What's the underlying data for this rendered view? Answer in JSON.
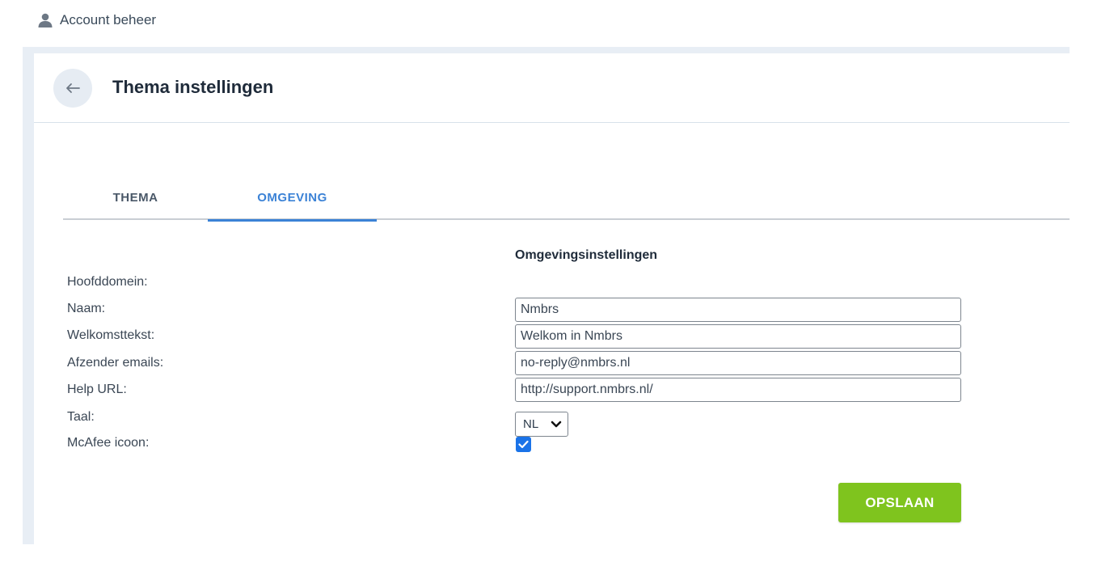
{
  "topbar": {
    "title": "Account beheer",
    "icon": "user-icon"
  },
  "header": {
    "title": "Thema instellingen",
    "back_icon": "arrow-left-icon"
  },
  "tabs": [
    {
      "label": "THEMA",
      "active": false
    },
    {
      "label": "OMGEVING",
      "active": true
    }
  ],
  "section": {
    "title": "Omgevingsinstellingen"
  },
  "form": {
    "hoofddomein": {
      "label": "Hoofddomein:"
    },
    "naam": {
      "label": "Naam:",
      "value": "Nmbrs"
    },
    "welkomsttekst": {
      "label": "Welkomsttekst:",
      "value": "Welkom in Nmbrs"
    },
    "afzender": {
      "label": "Afzender emails:",
      "value": "no-reply@nmbrs.nl"
    },
    "help_url": {
      "label": "Help URL:",
      "value": "http://support.nmbrs.nl/"
    },
    "taal": {
      "label": "Taal:",
      "value": "NL"
    },
    "mcafee": {
      "label": "McAfee icoon:",
      "checked": true
    }
  },
  "actions": {
    "save_label": "OPSLAAN"
  },
  "colors": {
    "accent": "#3b82d6",
    "save_button": "#7fc41e",
    "checkbox": "#1a73e8",
    "shell_background": "#e8eef5"
  }
}
